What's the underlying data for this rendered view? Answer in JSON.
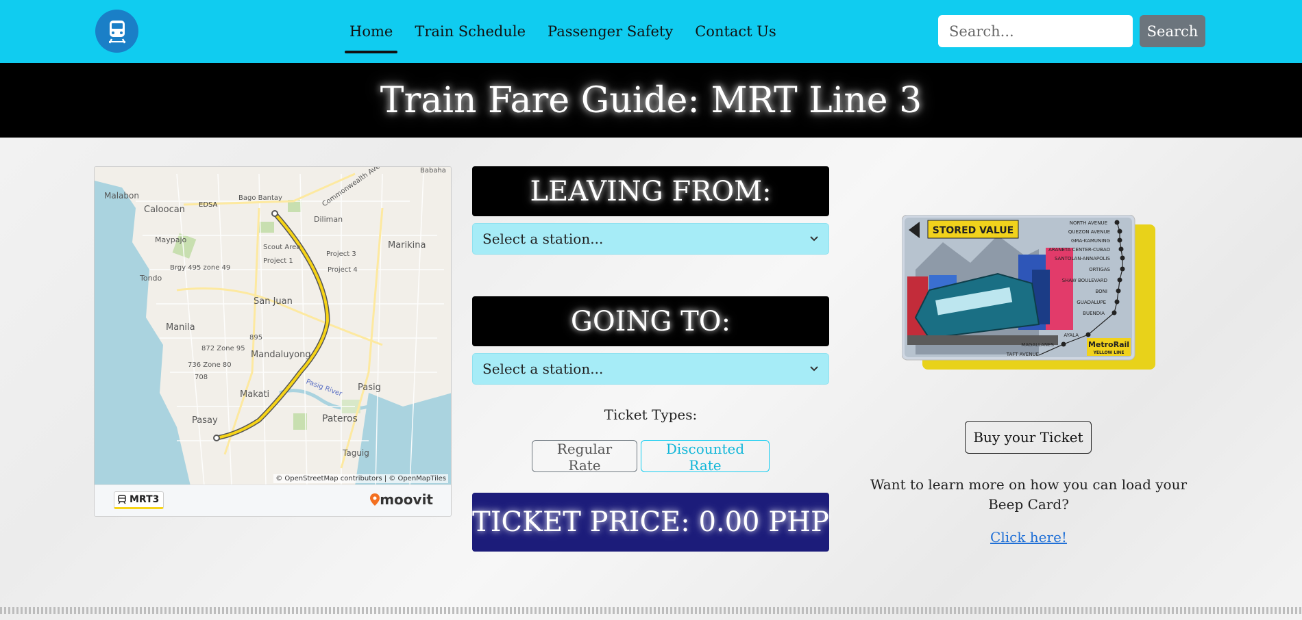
{
  "nav": {
    "logo_icon": "train-icon",
    "links": [
      "Home",
      "Train Schedule",
      "Passenger Safety",
      "Contact Us"
    ],
    "active": "Home",
    "search": {
      "placeholder": "Search...",
      "button": "Search"
    }
  },
  "title": "Train Fare Guide: MRT Line 3",
  "map": {
    "places": [
      "Babaha",
      "Malabon",
      "Caloocan",
      "EDSA",
      "Bago Bantay",
      "Commonwealth Ave",
      "Diliman",
      "Maypajo",
      "Scout Area",
      "Project 3",
      "Marikina",
      "Project 1",
      "Project 4",
      "Brgy 495 zone 49",
      "Tondo",
      "San Juan",
      "Manila",
      "895",
      "872 Zone 95",
      "Mandaluyong",
      "736 Zone 80",
      "708",
      "Pasig River",
      "Pasig",
      "Makati",
      "Pateros",
      "Pasay",
      "Taguig"
    ],
    "attribution": "© OpenStreetMap contributors | © OpenMapTiles",
    "line_badge": "MRT3",
    "brand": "moovit"
  },
  "leaving": {
    "label": "LEAVING FROM:",
    "placeholder": "Select a station..."
  },
  "going": {
    "label": "GOING TO:",
    "placeholder": "Select a station..."
  },
  "ticket_types": {
    "label": "Ticket Types:",
    "regular": "Regular Rate",
    "discounted": "Discounted Rate"
  },
  "price": "TICKET PRICE: 0.00 PHP",
  "card": {
    "stored_value": "STORED VALUE",
    "stations": [
      "NORTH AVENUE",
      "QUEZON AVENUE",
      "GMA-KAMUNING",
      "ARANETA CENTER-CUBAO",
      "SANTOLAN-ANNAPOLIS",
      "ORTIGAS",
      "SHAW BOULEVARD",
      "BONI",
      "GUADALUPE",
      "BUENDIA",
      "AYALA",
      "MAGALLANES",
      "TAFT AVENUE"
    ],
    "brand": "MetroRail",
    "line": "YELLOW LINE"
  },
  "buy_button": "Buy your Ticket",
  "learn_text": "Want to learn more on how you can load your Beep Card?",
  "click_link": "Click here!",
  "colors": {
    "nav": "#10ccf0",
    "price_bg": "#1c1c7a",
    "select_bg": "#a6ecf7",
    "mrt_line": "#f7d417"
  }
}
